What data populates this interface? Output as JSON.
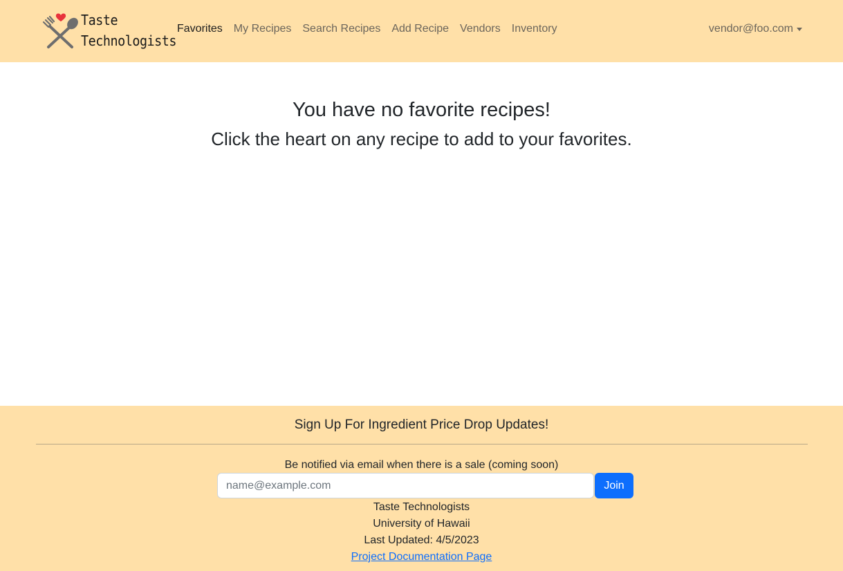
{
  "brand": {
    "line1": "Taste",
    "line2": "Technologists"
  },
  "nav": {
    "items": [
      {
        "label": "Favorites",
        "active": true
      },
      {
        "label": "My Recipes",
        "active": false
      },
      {
        "label": "Search Recipes",
        "active": false
      },
      {
        "label": "Add Recipe",
        "active": false
      },
      {
        "label": "Vendors",
        "active": false
      },
      {
        "label": "Inventory",
        "active": false
      }
    ],
    "user": "vendor@foo.com"
  },
  "main": {
    "title": "You have no favorite recipes!",
    "subtitle": "Click the heart on any recipe to add to your favorites."
  },
  "footer": {
    "heading": "Sign Up For Ingredient Price Drop Updates!",
    "note": "Be notified via email when there is a sale (coming soon)",
    "email_placeholder": "name@example.com",
    "email_value": "",
    "join_label": "Join",
    "org": "Taste Technologists",
    "university": "University of Hawaii",
    "updated": "Last Updated: 4/5/2023",
    "doc_link": "Project Documentation Page"
  },
  "colors": {
    "navbar_bg": "#ffe0a8",
    "footer_bg": "#ffe0a8",
    "primary": "#0d6efd",
    "heart": "#e8323c"
  },
  "icons": {
    "logo": "fork-spoon-heart-icon"
  }
}
